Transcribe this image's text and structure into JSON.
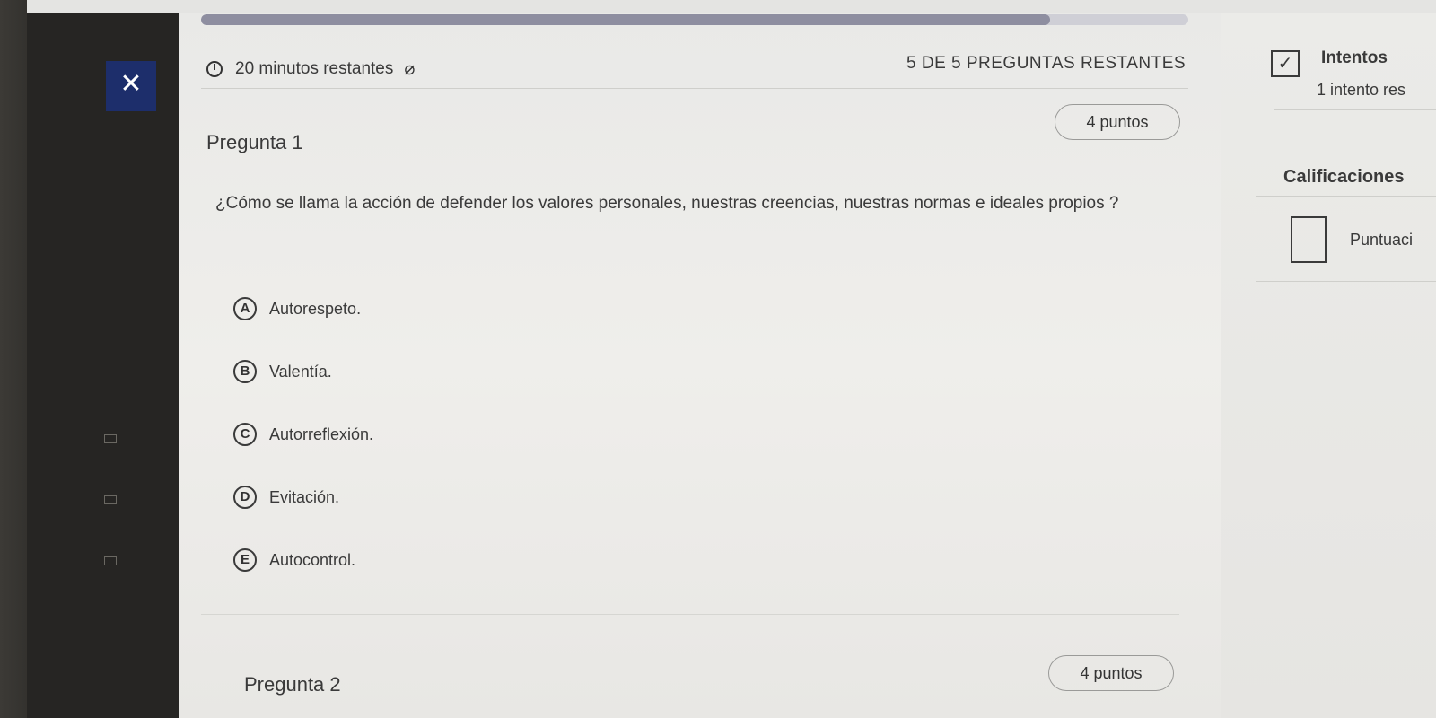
{
  "close_icon": "close-icon",
  "quiz": {
    "progress": 0.86,
    "timer_text": "20 minutos restantes",
    "remaining_text": "5 DE 5 PREGUNTAS RESTANTES"
  },
  "questions": [
    {
      "title": "Pregunta 1",
      "points": "4 puntos",
      "prompt": "¿Cómo se llama la acción de defender los valores personales, nuestras creencias, nuestras normas e ideales propios ?",
      "options": [
        {
          "letter": "A",
          "text": "Autorespeto."
        },
        {
          "letter": "B",
          "text": "Valentía."
        },
        {
          "letter": "C",
          "text": "Autorreflexión."
        },
        {
          "letter": "D",
          "text": "Evitación."
        },
        {
          "letter": "E",
          "text": "Autocontrol."
        }
      ]
    },
    {
      "title": "Pregunta 2",
      "points": "4 puntos"
    }
  ],
  "sidebar": {
    "attempts_title": "Intentos",
    "attempts_left": "1 intento res",
    "grades_title": "Calificaciones",
    "score_label": "Puntuaci"
  }
}
